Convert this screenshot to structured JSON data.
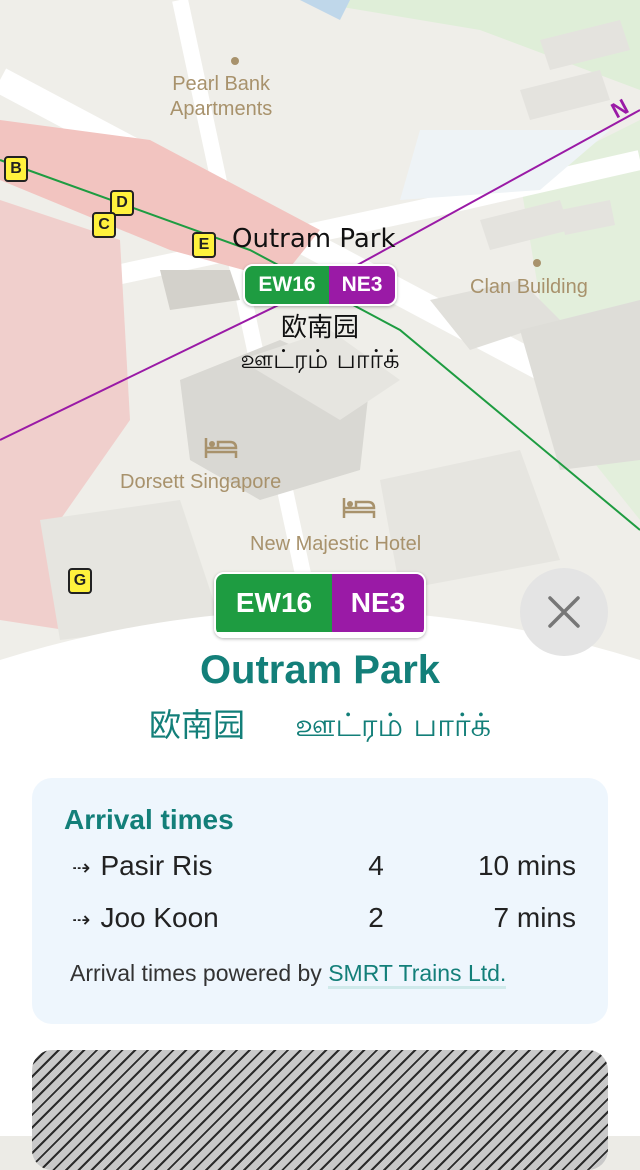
{
  "map": {
    "poi": {
      "pearl_bank": "Pearl Bank\nApartments",
      "clan_building": "Clan Building",
      "dorsett": "Dorsett Singapore",
      "new_majestic": "New Majestic Hotel",
      "line_label": "N"
    },
    "exits": [
      "B",
      "D",
      "C",
      "E",
      "G"
    ],
    "station_label": "Outram Park",
    "codes": {
      "ew": "EW16",
      "ne": "NE3"
    },
    "name_chinese": "欧南园",
    "name_tamil": "ஊட்ரம் பார்க்",
    "colors": {
      "ew": "#1e9c41",
      "ne": "#9a1aa6"
    }
  },
  "sheet": {
    "codes": {
      "ew": "EW16",
      "ne": "NE3"
    },
    "title": "Outram Park",
    "name_chinese": "欧南园",
    "name_tamil": "ஊட்ரம் பார்க்",
    "close_icon": "close-icon",
    "arrivals": {
      "heading": "Arrival times",
      "rows": [
        {
          "arrow": "⇢",
          "destination": "Pasir Ris",
          "platform": "4",
          "time": "10 mins"
        },
        {
          "arrow": "⇢",
          "destination": "Joo Koon",
          "platform": "2",
          "time": "7 mins"
        }
      ],
      "powered_prefix": "Arrival times powered by",
      "powered_link": "SMRT Trains Ltd."
    },
    "accent": "#137f79"
  }
}
